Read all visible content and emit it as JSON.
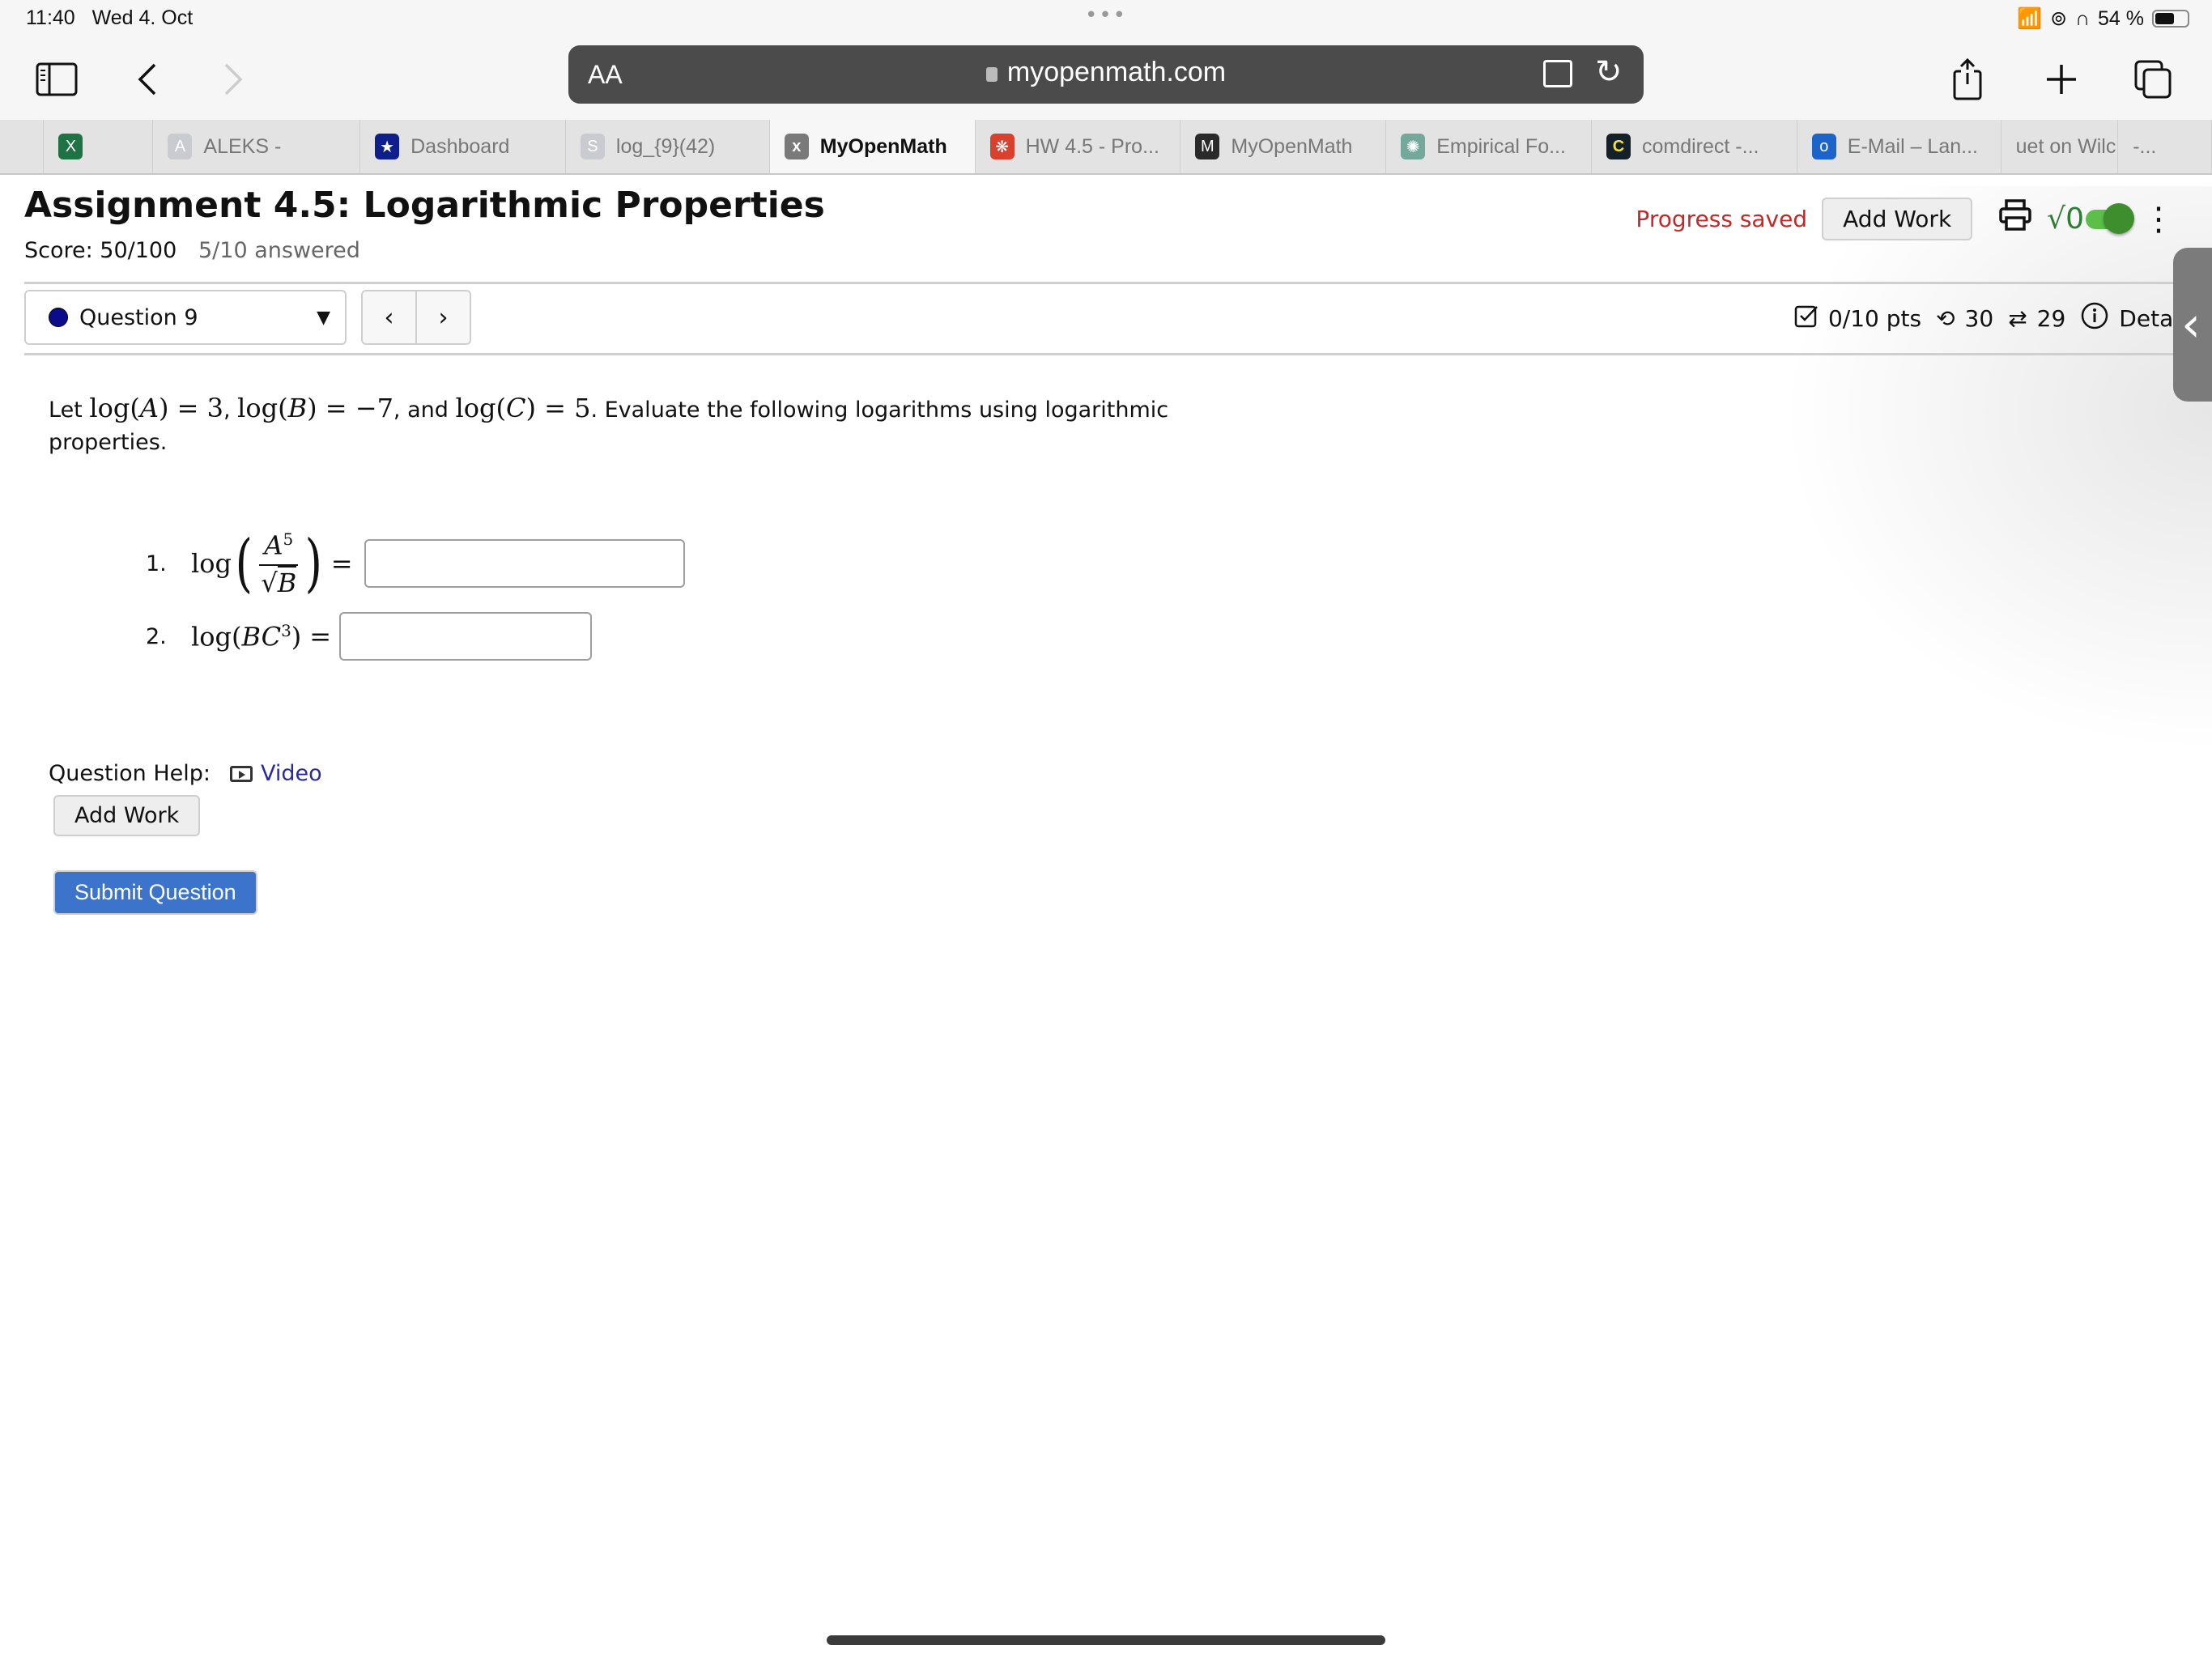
{
  "status_bar": {
    "time": "11:40",
    "date": "Wed 4. Oct",
    "battery": "54 %",
    "battery_level": 0.54,
    "icons": [
      "wifi-icon",
      "orientation-lock-icon",
      "headphones-icon",
      "battery-icon"
    ]
  },
  "browser": {
    "url": "myopenmath.com",
    "reader_label": "AA",
    "icons": [
      "sidebar-icon",
      "back-icon",
      "forward-icon",
      "lock-icon",
      "extension-icon",
      "reload-icon",
      "share-icon",
      "new-tab-icon",
      "tabs-icon"
    ],
    "tabs": [
      {
        "label": "",
        "favicon": "X",
        "favicon_color": "#1f7244"
      },
      {
        "label": "ALEKS -",
        "favicon": "A",
        "favicon_color": "#c9cbd1"
      },
      {
        "label": "Dashboard",
        "favicon": "★",
        "favicon_color": "#0e1f8c"
      },
      {
        "label": "log_{9}(42)",
        "favicon": "S",
        "favicon_color": "#c9cbd1"
      },
      {
        "label": "MyOpenMath",
        "favicon": "x",
        "favicon_color": "#7a7a7a",
        "active": true
      },
      {
        "label": "HW 4.5 - Pro...",
        "favicon": "❋",
        "favicon_color": "#d9412f"
      },
      {
        "label": "MyOpenMath",
        "favicon": "M",
        "favicon_color": "#2a2a2a"
      },
      {
        "label": "Empirical Fo...",
        "favicon": "✺",
        "favicon_color": "#74a89a"
      },
      {
        "label": "comdirect -...",
        "favicon": "C",
        "favicon_color": "#14202a"
      },
      {
        "label": "E-Mail – Lan...",
        "favicon": "o",
        "favicon_color": "#1b64c9"
      },
      {
        "label": "uet on Wilc...",
        "favicon": "",
        "favicon_color": ""
      },
      {
        "label": "-...",
        "favicon": "",
        "favicon_color": ""
      }
    ]
  },
  "assignment": {
    "title": "Assignment 4.5: Logarithmic Properties",
    "score": "Score: 50/100",
    "answered": "5/10 answered",
    "progress_saved": "Progress saved",
    "add_work": "Add Work",
    "sqrt_label": "√0",
    "colors": {
      "progress_saved": "#c62828",
      "toggle": "#5cbf4a",
      "submit": "#3c74cc",
      "link": "#2a2a9c",
      "question_dot": "#0b0b8c"
    }
  },
  "question_bar": {
    "selected": "Question 9",
    "prev": "‹",
    "next": "›",
    "points": "0/10 pts",
    "retries": "30",
    "regens": "29",
    "details": "Detai"
  },
  "question": {
    "intro_let": "Let",
    "given": [
      {
        "lhs": "log",
        "var": "A",
        "rhs": "3"
      },
      {
        "lhs": "log",
        "var": "B",
        "rhs": "−7"
      },
      {
        "lhs": "log",
        "var": "C",
        "rhs": "5"
      }
    ],
    "sep1": ",",
    "sep2": ", and",
    "instruction": ". Evaluate the following logarithms using logarithmic properties.",
    "items": [
      {
        "number": "1.",
        "expression": "log(A^5 / √B)",
        "num_base": "A",
        "num_exp": "5",
        "den": "B",
        "value": ""
      },
      {
        "number": "2.",
        "expression": "log(BC^3)",
        "base": "BC",
        "exp": "3",
        "value": ""
      }
    ],
    "help_label": "Question Help:",
    "video_label": "Video",
    "add_work": "Add Work",
    "submit": "Submit Question"
  }
}
